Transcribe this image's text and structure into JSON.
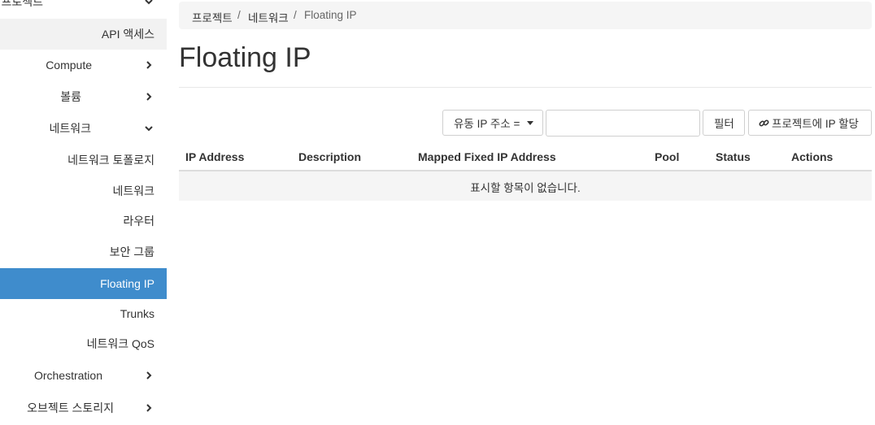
{
  "sidebar": {
    "items": [
      {
        "label": "프로젝트"
      },
      {
        "label": "API 액세스"
      },
      {
        "label": "Compute"
      },
      {
        "label": "볼륨"
      },
      {
        "label": "네트워크"
      },
      {
        "label": "네트워크 토폴로지"
      },
      {
        "label": "네트워크"
      },
      {
        "label": "라우터"
      },
      {
        "label": "보안 그룹"
      },
      {
        "label": "Floating IP"
      },
      {
        "label": "Trunks"
      },
      {
        "label": "네트워크 QoS"
      },
      {
        "label": "Orchestration"
      },
      {
        "label": "오브젝트 스토리지"
      }
    ]
  },
  "breadcrumb": {
    "items": [
      "프로젝트",
      "네트워크",
      "Floating IP"
    ],
    "separator": "/"
  },
  "page": {
    "title": "Floating IP"
  },
  "toolbar": {
    "filter_select": "유동 IP 주소 =",
    "filter_value": "",
    "filter_button": "필터",
    "allocate_button": "프로젝트에 IP 할당"
  },
  "table": {
    "columns": [
      "IP Address",
      "Description",
      "Mapped Fixed IP Address",
      "Pool",
      "Status",
      "Actions"
    ],
    "empty_message": "표시할 항목이 없습니다."
  },
  "colors": {
    "active": "#3f8ccc",
    "sidebar_highlight": "#f2f2f2"
  }
}
